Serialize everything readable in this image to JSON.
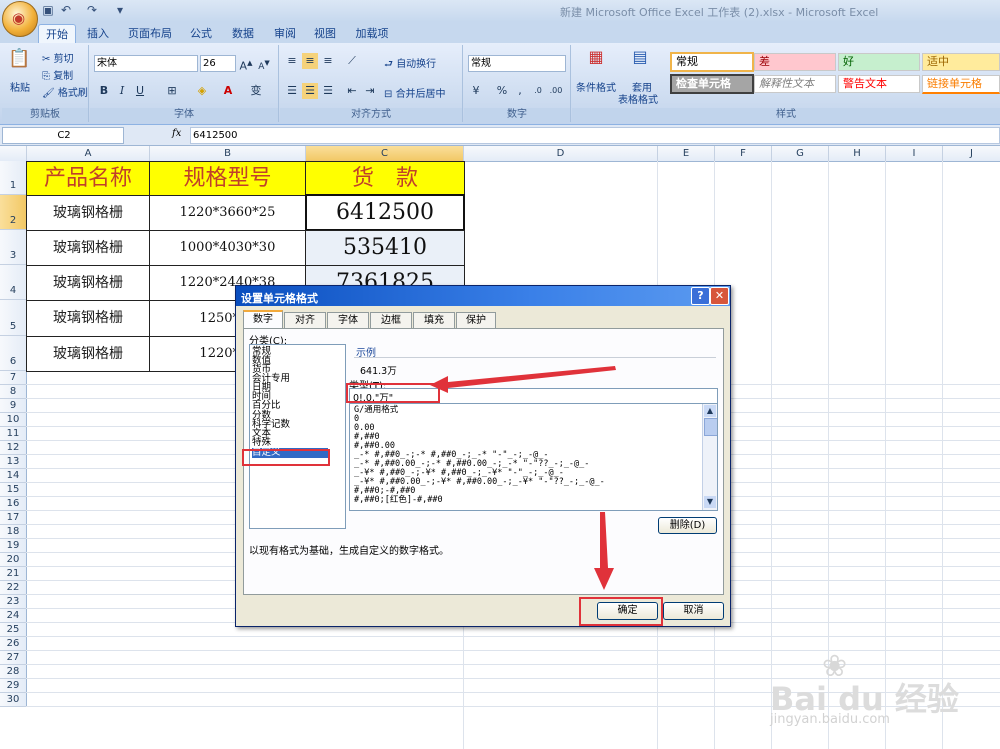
{
  "window": {
    "title": "新建 Microsoft Office Excel 工作表 (2).xlsx - Microsoft Excel"
  },
  "qat": {
    "save_icon": "save-icon",
    "undo_icon": "undo-icon",
    "redo_icon": "redo-icon"
  },
  "tabs": [
    "开始",
    "插入",
    "页面布局",
    "公式",
    "数据",
    "审阅",
    "视图",
    "加载项"
  ],
  "ribbon": {
    "clipboard": {
      "paste": "粘贴",
      "cut": "剪切",
      "copy": "复制",
      "format_painter": "格式刷",
      "label": "剪贴板"
    },
    "font": {
      "name": "宋体",
      "size": "26",
      "bold": "B",
      "italic": "I",
      "underline": "U",
      "label": "字体"
    },
    "alignment": {
      "wrap": "自动换行",
      "merge": "合并后居中",
      "label": "对齐方式"
    },
    "number": {
      "format": "常规",
      "percent": "%",
      "comma": ",",
      "label": "数字"
    },
    "styles": {
      "conditional": "条件格式",
      "table1": "套用",
      "table2": "表格格式",
      "cells": [
        "常规",
        "差",
        "好",
        "适中",
        "检查单元格",
        "解释性文本",
        "警告文本",
        "链接单元格"
      ],
      "label": "样式"
    }
  },
  "formula_bar": {
    "name_box": "C2",
    "fx": "fx",
    "value": "6412500"
  },
  "columns": [
    "A",
    "B",
    "C",
    "D",
    "E",
    "F",
    "G",
    "H",
    "I",
    "J"
  ],
  "rows": [
    "1",
    "2",
    "3",
    "4",
    "5",
    "6",
    "7",
    "8",
    "9",
    "10",
    "11",
    "12",
    "13",
    "14",
    "15",
    "16",
    "17",
    "18",
    "19",
    "20",
    "21",
    "22",
    "23",
    "24",
    "25",
    "26",
    "27",
    "28",
    "29",
    "30"
  ],
  "table": {
    "headers": [
      "产品名称",
      "规格型号",
      "货　款"
    ],
    "rows": [
      [
        "玻璃钢格栅",
        "1220*3660*25",
        "6412500"
      ],
      [
        "玻璃钢格栅",
        "1000*4030*30",
        "535410"
      ],
      [
        "玻璃钢格栅",
        "1220*2440*38",
        "7361825"
      ],
      [
        "玻璃钢格栅",
        "1250*40",
        ""
      ],
      [
        "玻璃钢格栅",
        "1220*40",
        ""
      ]
    ]
  },
  "dialog": {
    "title": "设置单元格格式",
    "tabs": [
      "数字",
      "对齐",
      "字体",
      "边框",
      "填充",
      "保护"
    ],
    "category_label": "分类(C):",
    "categories": [
      "常规",
      "数值",
      "货币",
      "会计专用",
      "日期",
      "时间",
      "百分比",
      "分数",
      "科学记数",
      "文本",
      "特殊",
      "自定义"
    ],
    "selected_category": "自定义",
    "sample_label": "示例",
    "sample_value": "641.3万",
    "type_label": "类型(T):",
    "type_value": "0!.0,\"万\"",
    "formats": [
      "G/通用格式",
      "0",
      "0.00",
      "#,##0",
      "#,##0.00",
      "_-* #,##0_-;-* #,##0_-;_-* \"-\"_-;_-@_-",
      "_-* #,##0.00_-;-* #,##0.00_-;_-* \"-\"??_-;_-@_-",
      "_-¥* #,##0_-;-¥* #,##0_-;_-¥* \"-\"_-;_-@_-",
      "_-¥* #,##0.00_-;-¥* #,##0.00_-;_-¥* \"-\"??_-;_-@_-",
      "#,##0;-#,##0",
      "#,##0;[红色]-#,##0"
    ],
    "delete_button": "删除(D)",
    "description": "以现有格式为基础，生成自定义的数字格式。",
    "ok_button": "确定",
    "cancel_button": "取消"
  },
  "colors": {
    "header_fill": "#ffff00",
    "header_text": "#c0402a",
    "annotation": "#e0323a"
  }
}
